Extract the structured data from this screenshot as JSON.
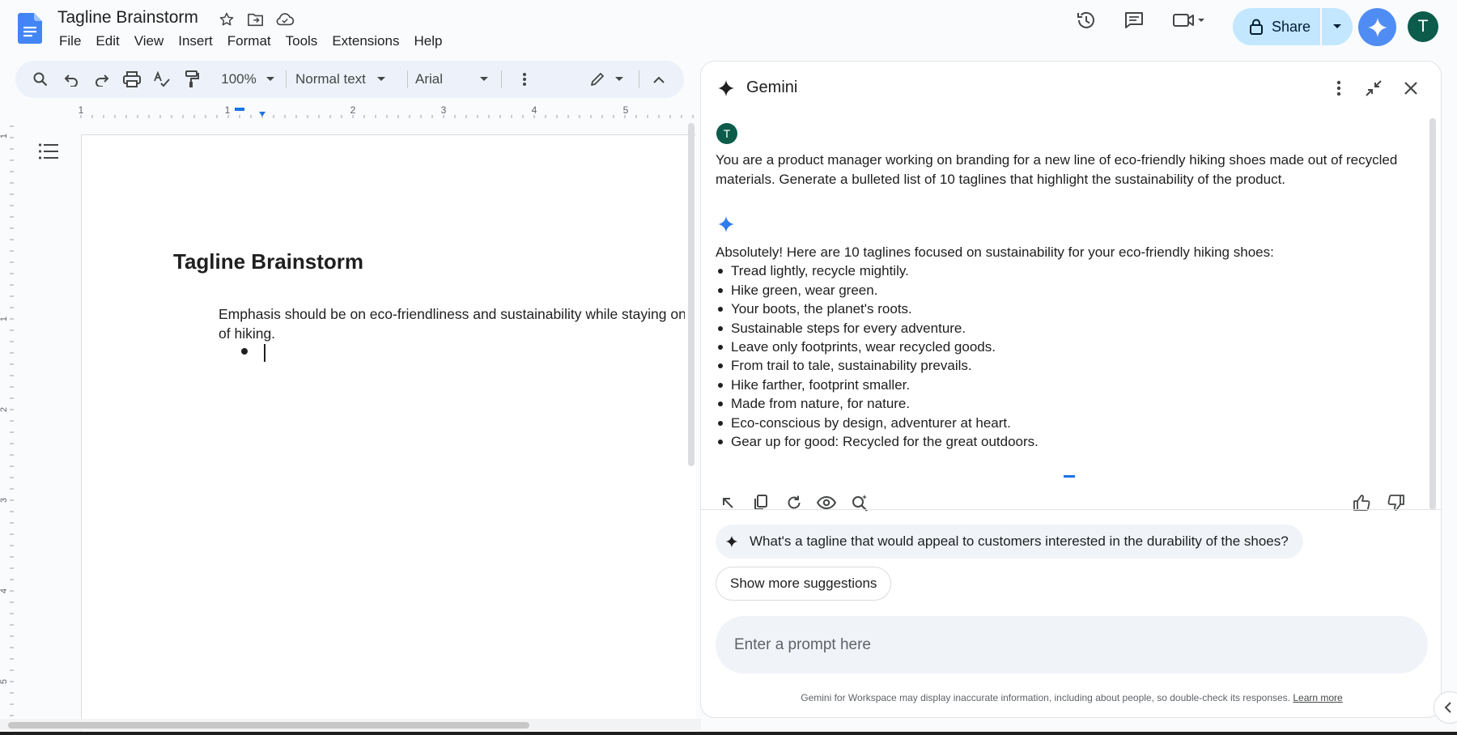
{
  "header": {
    "doc_title": "Tagline Brainstorm",
    "menu": [
      "File",
      "Edit",
      "View",
      "Insert",
      "Format",
      "Tools",
      "Extensions",
      "Help"
    ],
    "share_label": "Share",
    "avatar_letter": "T",
    "icons": [
      "docs-logo-icon",
      "star-icon",
      "move-folder-icon",
      "cloud-status-icon",
      "version-history-icon",
      "comments-icon",
      "meet-icon",
      "lock-icon",
      "gemini-icon"
    ]
  },
  "toolbar": {
    "zoom": "100%",
    "style": "Normal text",
    "font": "Arial"
  },
  "ruler": {
    "marks": [
      "1",
      "1",
      "2",
      "3",
      "4",
      "5"
    ],
    "vertical_marks": [
      "1",
      "1",
      "2",
      "3",
      "4",
      "5"
    ]
  },
  "document": {
    "heading": "Tagline Brainstorm",
    "paragraph_line1": "Emphasis should be on eco-friendliness and sustainability while staying on",
    "paragraph_line2": "of hiking."
  },
  "gemini": {
    "title": "Gemini",
    "user_avatar": "T",
    "prompt_line1": "You are a product manager working on branding for a new line of eco-friendly hiking shoes made out of recycled",
    "prompt_line2": "materials. Generate a bulleted list of 10 taglines that highlight the sustainability of the product.",
    "response_intro": "Absolutely! Here are 10 taglines focused on sustainability for your eco-friendly hiking shoes:",
    "taglines": [
      "Tread lightly, recycle mightily.",
      "Hike green, wear green.",
      "Your boots, the planet's roots.",
      "Sustainable steps for every adventure.",
      "Leave only footprints, wear recycled goods.",
      "From trail to tale, sustainability prevails.",
      "Hike farther, footprint smaller.",
      "Made from nature, for nature.",
      "Eco-conscious by design, adventurer at heart.",
      "Gear up for good: Recycled for the great outdoors."
    ],
    "suggestion": "What's a tagline that would appeal to customers interested in the durability of the shoes?",
    "more_suggestions": "Show more suggestions",
    "input_placeholder": "Enter a prompt here",
    "disclaimer": "Gemini for Workspace may display inaccurate information, including about people, so double-check its responses.",
    "learn_more": "Learn more"
  },
  "colors": {
    "accent": "#1a73e8",
    "share_bg": "#c2e7ff",
    "avatar_bg": "#0d5c4b",
    "toolbar_bg": "#edf2fa",
    "gemini_blue": "#4f8df5"
  }
}
